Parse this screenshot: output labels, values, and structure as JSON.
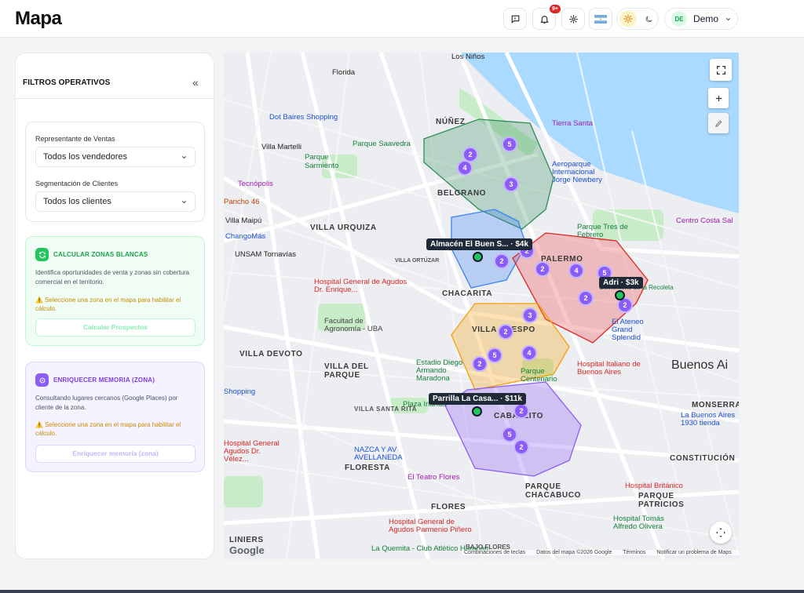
{
  "app": {
    "title": "Mapa"
  },
  "header": {
    "notifications_badge": "9+",
    "user": {
      "initials": "DE",
      "name": "Demo"
    }
  },
  "sidebar": {
    "title": "FILTROS OPERATIVOS",
    "collapse": "«",
    "filters": {
      "sales_rep_label": "Representante de Ventas",
      "sales_rep_value": "Todos los vendedores",
      "segment_label": "Segmentación de Clientes",
      "segment_value": "Todos los clientes"
    },
    "white_zones": {
      "title": "CALCULAR ZONAS BLANCAS",
      "description": "Identifica oportunidades de venta y zonas sin cobertura comercial en el territorio.",
      "warning": "⚠️ Seleccione una zona en el mapa para habilitar el cálculo.",
      "button": "Calcular Prospectos"
    },
    "memory": {
      "title": "ENRIQUECER MEMORIA (ZONA)",
      "description": "Consultando lugares cercanos (Google Places) por cliente de la zona.",
      "warning": "⚠️ Seleccione una zona en el mapa para habilitar el cálculo.",
      "button": "Enriquecer memoria (zona)"
    }
  },
  "map": {
    "labels": {
      "nunez": "NÚÑEZ",
      "belgrano": "BELGRANO",
      "villa_urquiza": "VILLA URQUIZA",
      "chacarita": "CHACARITA",
      "palermo": "PALERMO",
      "villa_crespo": "VILLA CRESPO",
      "villa_devoto": "VILLA DEVOTO",
      "villa_del_parque": "VILLA DEL PARQUE",
      "villa_santa_rita": "VILLA SANTA RITA",
      "caballito": "CABALLITO",
      "floresta": "FLORESTA",
      "flores": "FLORES",
      "parque_chacabuco": "PARQUE CHACABUCO",
      "parque_patricios": "PARQUE PATRICIOS",
      "monserrat": "MONSERRAT",
      "constitucion": "CONSTITUCIÓN",
      "liniers": "LINIERS",
      "bajo_flores": "BAJO FLORES",
      "villa_ortuzar": "VILLA ORTÚZAR",
      "villa_martelli": "Villa Martelli",
      "villa_maipu": "Villa Maipú",
      "florida": "Florida",
      "los_ninos": "Los Niños",
      "buenos_aires": "Buenos Ai",
      "tecnopolis": "Tecnópolis",
      "dot_baires": "Dot Baires Shopping",
      "parque_saavedra": "Parque Saavedra",
      "parque_sarmiento": "Parque Sarmiento",
      "tierra_santa": "Tierra Santa",
      "aeroparque": "Aeroparque Internacional Jorge Newbery",
      "centro_costa": "Centro Costa Sal",
      "parque_tres_febrero": "Parque Tres de Febrero",
      "hospital_velez_sarsfield": "Hospital General de Agudos Dr. Enrique...",
      "facultad_agronomia": "Facultad de Agronomía - UBA",
      "estadio_maradona": "Estadio Diego Armando Maradona",
      "hospital_italiano": "Hospital Italiano de Buenos Aires",
      "el_ateneo": "El Ateneo Grand Splendid",
      "parque_centenario": "Parque Centenario",
      "nazca": "NAZCA Y AV AVELLANEDA",
      "teatro_flores": "El Teatro Flores",
      "hospital_velez": "Hospital General Agudos Dr. Vélez...",
      "hospital_pinero": "Hospital General de Agudos Parmenio Piñero",
      "hospital_britanico": "Hospital Británico",
      "hospital_tomas": "Hospital Tomás Alfredo Olivera",
      "quemita": "La Quemita - Club Atlético Huracán",
      "buenos_aires_1930": "La Buenos Aires 1930 tienda",
      "recoleta": "Cementerio de la Recoleta",
      "chango_mas": "ChangoMás",
      "unsam": "UNSAM Tornavías",
      "plaza_irlanda": "Plaza Irlanda",
      "pancho": "Pancho 46",
      "shopping": "Shopping"
    },
    "clusters": [
      {
        "id": "a",
        "count": "2"
      },
      {
        "id": "b",
        "count": "4"
      },
      {
        "id": "c",
        "count": "5"
      },
      {
        "id": "d",
        "count": "3"
      },
      {
        "id": "e",
        "count": "2"
      },
      {
        "id": "f",
        "count": "2"
      },
      {
        "id": "g",
        "count": "2"
      },
      {
        "id": "h",
        "count": "4"
      },
      {
        "id": "i",
        "count": "5"
      },
      {
        "id": "j",
        "count": "2"
      },
      {
        "id": "k",
        "count": "2"
      },
      {
        "id": "l",
        "count": "3"
      },
      {
        "id": "m",
        "count": "2"
      },
      {
        "id": "n",
        "count": "5"
      },
      {
        "id": "o",
        "count": "4"
      },
      {
        "id": "p",
        "count": "2"
      },
      {
        "id": "q",
        "count": "2"
      },
      {
        "id": "r",
        "count": "5"
      },
      {
        "id": "s",
        "count": "2"
      }
    ],
    "clients": [
      {
        "label": "Almacén El Buen S... · $4k"
      },
      {
        "label": "Adri · $3k"
      },
      {
        "label": "Parrilla La Casa... · $11k"
      }
    ],
    "zone_colors": {
      "nunez": "#2e8b57",
      "chacarita": "#3b82f6",
      "palermo": "#ef4444",
      "villa_crespo": "#f59e0b",
      "caballito": "#8b5cf6"
    },
    "attribution": {
      "google": "Google",
      "shortcuts": "Combinaciones de teclas",
      "data": "Datos del mapa ©2026 Google",
      "terms": "Términos",
      "report": "Notificar un problema de Maps"
    }
  }
}
